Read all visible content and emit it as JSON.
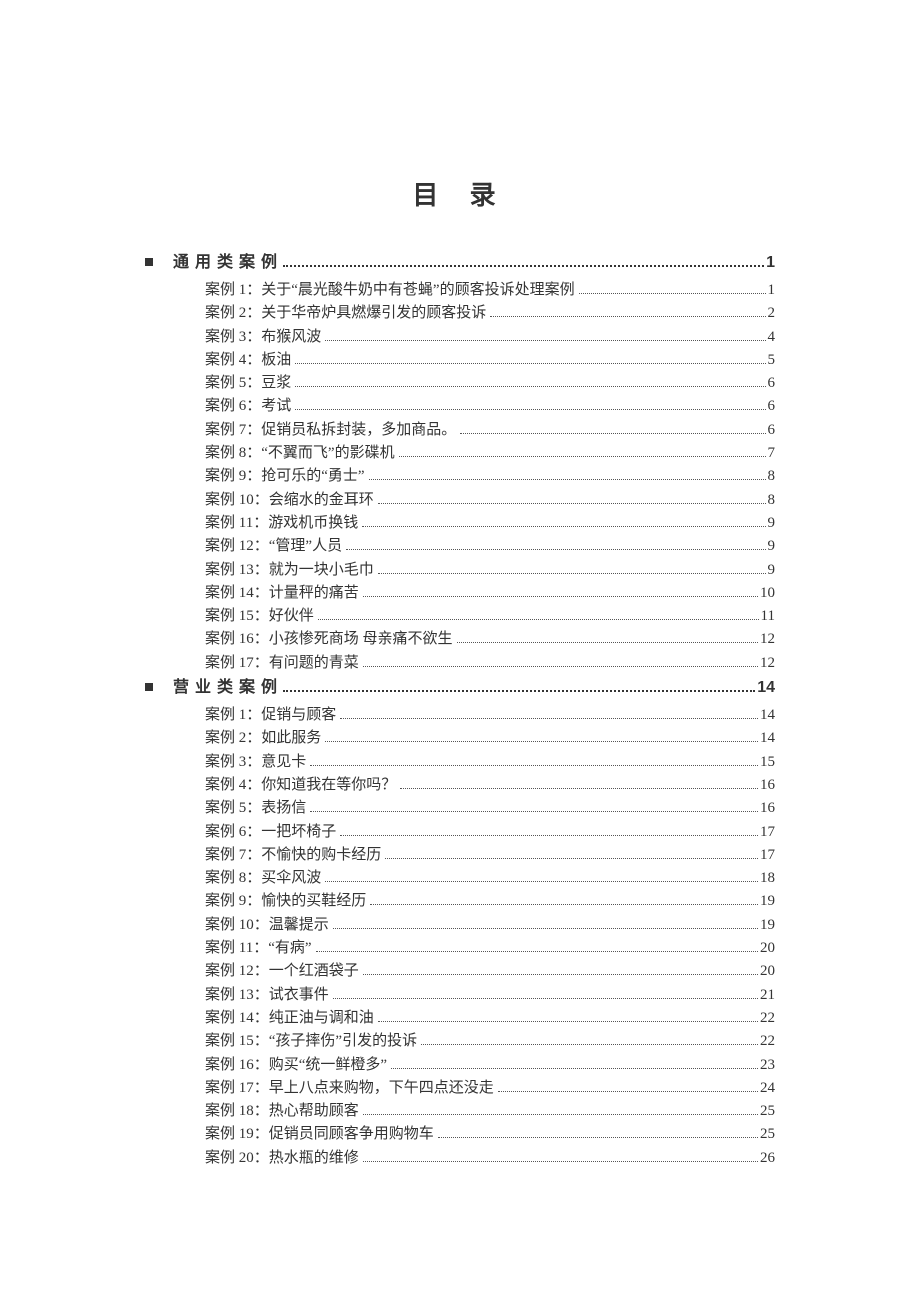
{
  "title": "目 录",
  "sections": [
    {
      "label": "通用类案例",
      "page": "1",
      "entries": [
        {
          "label": "案例 1：关于“晨光酸牛奶中有苍蝇”的顾客投诉处理案例",
          "page": "1"
        },
        {
          "label": "案例 2：关于华帝炉具燃爆引发的顾客投诉",
          "page": "2"
        },
        {
          "label": "案例 3：布猴风波",
          "page": "4"
        },
        {
          "label": "案例 4：板油",
          "page": "5"
        },
        {
          "label": "案例 5：豆浆",
          "page": "6"
        },
        {
          "label": "案例 6：考试",
          "page": "6"
        },
        {
          "label": "案例 7：促销员私拆封装，多加商品。",
          "page": "6"
        },
        {
          "label": "案例 8：“不翼而飞”的影碟机",
          "page": "7"
        },
        {
          "label": "案例 9：抢可乐的“勇士”",
          "page": "8"
        },
        {
          "label": "案例 10：会缩水的金耳环",
          "page": "8"
        },
        {
          "label": "案例 11：游戏机币换钱",
          "page": "9"
        },
        {
          "label": "案例 12：“管理”人员",
          "page": "9"
        },
        {
          "label": "案例 13：就为一块小毛巾",
          "page": "9"
        },
        {
          "label": "案例 14：计量秤的痛苦",
          "page": "10"
        },
        {
          "label": "案例 15：好伙伴",
          "page": "11"
        },
        {
          "label": "案例 16：小孩惨死商场  母亲痛不欲生",
          "page": "12"
        },
        {
          "label": "案例 17：有问题的青菜",
          "page": "12"
        }
      ]
    },
    {
      "label": "营业类案例",
      "page": "14",
      "entries": [
        {
          "label": "案例 1：促销与顾客",
          "page": "14"
        },
        {
          "label": "案例 2：如此服务",
          "page": "14"
        },
        {
          "label": "案例 3：意见卡",
          "page": "15"
        },
        {
          "label": "案例 4：你知道我在等你吗？",
          "page": "16"
        },
        {
          "label": "案例 5：表扬信",
          "page": "16"
        },
        {
          "label": "案例 6：一把坏椅子",
          "page": "17"
        },
        {
          "label": "案例 7：不愉快的购卡经历",
          "page": "17"
        },
        {
          "label": "案例 8：买伞风波",
          "page": "18"
        },
        {
          "label": "案例 9：愉快的买鞋经历",
          "page": "19"
        },
        {
          "label": "案例 10：温馨提示",
          "page": "19"
        },
        {
          "label": "案例 11：“有病”",
          "page": "20"
        },
        {
          "label": "案例 12：一个红酒袋子",
          "page": "20"
        },
        {
          "label": "案例 13：试衣事件",
          "page": "21"
        },
        {
          "label": "案例 14：纯正油与调和油",
          "page": "22"
        },
        {
          "label": "案例 15：“孩子摔伤”引发的投诉",
          "page": "22"
        },
        {
          "label": "案例 16：购买“统一鲜橙多”",
          "page": "23"
        },
        {
          "label": "案例 17：早上八点来购物，下午四点还没走",
          "page": "24"
        },
        {
          "label": "案例 18：热心帮助顾客",
          "page": "25"
        },
        {
          "label": "案例 19：促销员同顾客争用购物车",
          "page": "25"
        },
        {
          "label": "案例 20：热水瓶的维修",
          "page": "26"
        }
      ]
    }
  ]
}
